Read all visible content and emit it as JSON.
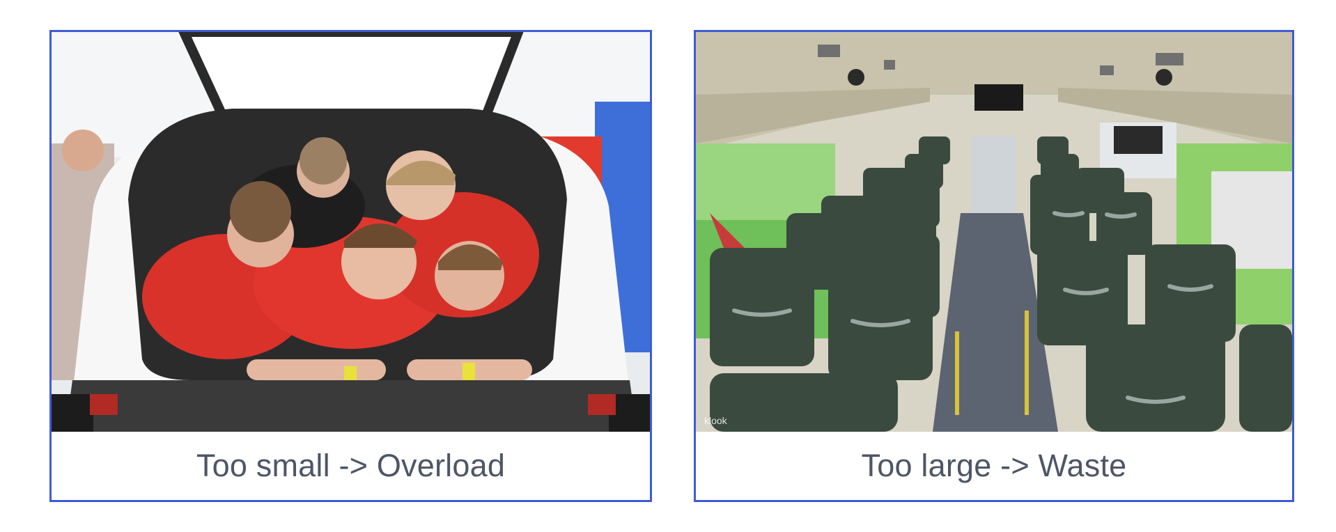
{
  "panels": [
    {
      "image_subject": "people-crammed-in-car-trunk",
      "caption": "Too small -> Overload"
    },
    {
      "image_subject": "empty-bus-interior",
      "caption": "Too large -> Waste",
      "watermark": "klook"
    }
  ],
  "colors": {
    "frame_border": "#3f5bd6",
    "caption_text": "#4d5566",
    "background": "#ffffff"
  }
}
